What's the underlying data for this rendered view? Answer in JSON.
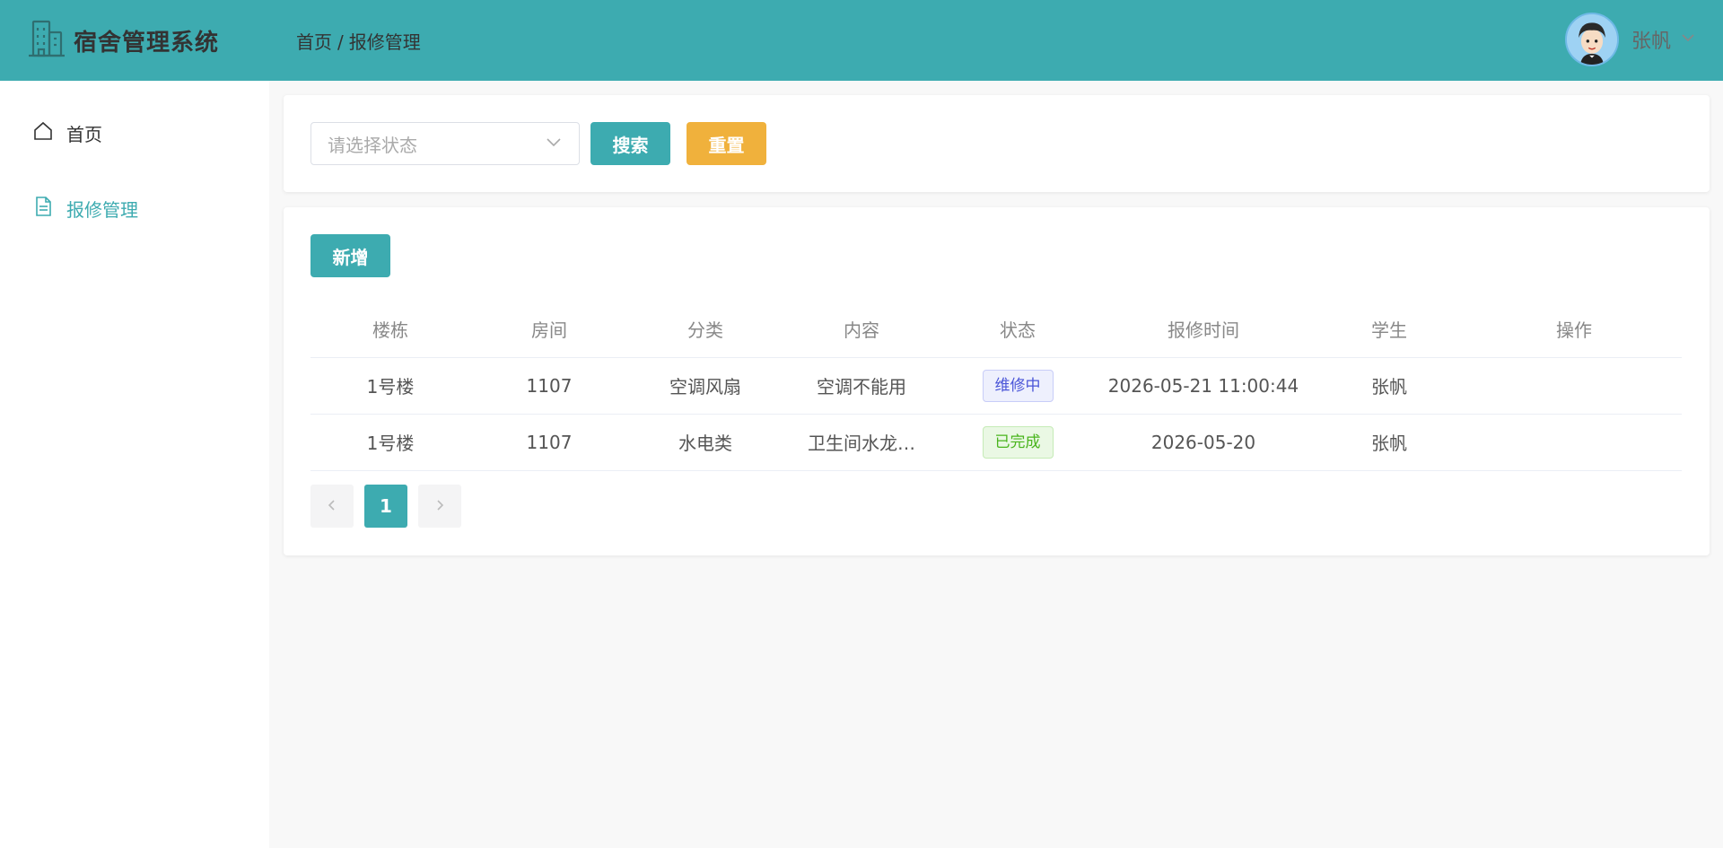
{
  "app": {
    "title": "宿舍管理系统"
  },
  "breadcrumb": {
    "home": "首页",
    "separator": "/",
    "current": "报修管理"
  },
  "user": {
    "name": "张帆",
    "avatar_icon": "avatar-icon"
  },
  "sidebar": {
    "items": [
      {
        "label": "首页",
        "icon": "home-icon",
        "active": false
      },
      {
        "label": "报修管理",
        "icon": "document-icon",
        "active": true
      }
    ]
  },
  "search": {
    "status_placeholder": "请选择状态",
    "search_label": "搜索",
    "reset_label": "重置"
  },
  "toolbar": {
    "add_label": "新增"
  },
  "table": {
    "headers": [
      "楼栋",
      "房间",
      "分类",
      "内容",
      "状态",
      "报修时间",
      "学生",
      "操作"
    ],
    "rows": [
      {
        "building": "1号楼",
        "room": "1107",
        "category": "空调风扇",
        "content": "空调不能用",
        "status": "维修中",
        "time": "2026-05-21 11:00:44",
        "student": "张帆",
        "action": ""
      },
      {
        "building": "1号楼",
        "room": "1107",
        "category": "水电类",
        "content": "卫生间水龙…",
        "status": "已完成",
        "time": "2026-05-20",
        "student": "张帆",
        "action": ""
      }
    ]
  },
  "pagination": {
    "current_page": "1"
  },
  "colors": {
    "primary": "#3dabb0",
    "warning": "#f0b13c",
    "status_in_progress": "#4a55d8",
    "status_done": "#49b51d"
  }
}
